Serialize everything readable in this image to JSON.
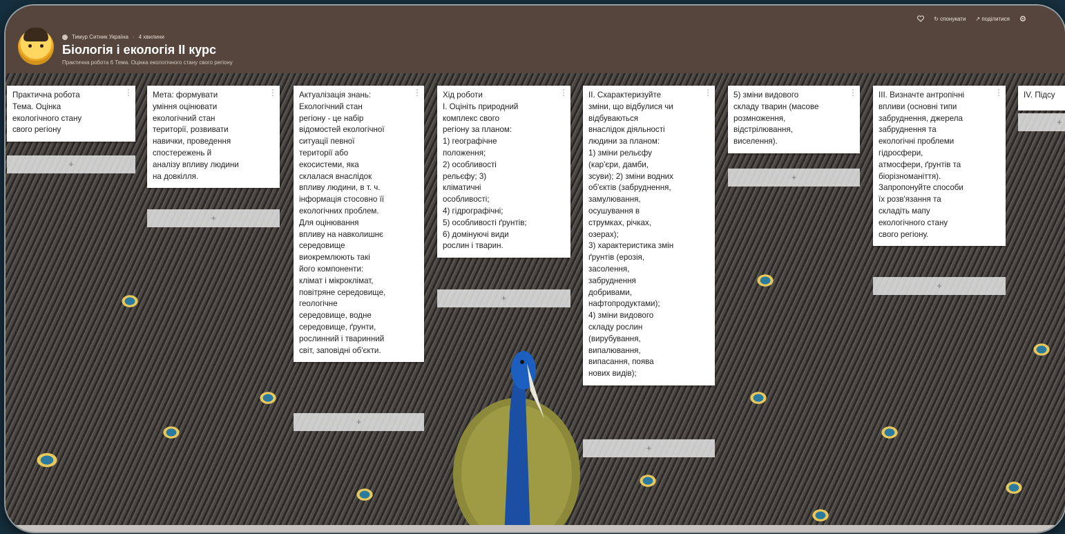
{
  "header": {
    "breadcrumb_owner": "Тимур Ситник Україна",
    "breadcrumb_sep": "·",
    "breadcrumb_count": "4 хвилини",
    "title": "Біологія і екологія ІІ курс",
    "subtitle": "Практична робота 6 Тема. Оцінка екологічного стану свого регіону",
    "actions": {
      "remake": "↻ спонукати",
      "share": "↗ поділитися"
    }
  },
  "columns": [
    {
      "text": "Практична робота\nТема. Оцінка\nекологічного стану\nсвого регіону",
      "add_label": "+"
    },
    {
      "text": "Мета: формувати\nуміння оцінювати\nекологічний стан\nтериторії, розвивати\nнавички, проведення\nспостережень й\nаналізу впливу людини\nна довкілля.",
      "add_label": "+"
    },
    {
      "text": "Актуалізація знань:\nЕкологічний стан\nрегіону - це набір\nвідомостей екологічної\nситуації певної\nтериторії або\nекосистеми, яка\nсклалася внаслідок\nвпливу людини, в т. ч.\nінформація стосовно її\nекологічних проблем.\nДля оцінювання\nвпливу на навколишнє\nсередовище\nвиокремлюють такі\nйого компоненти:\nклімат і мікроклімат,\nповітряне середовище,\nгеологічне\nсередовище, водне\nсередовище, ґрунти,\nрослинний і тваринний\nсвіт, заповідні об'єкти.",
      "add_label": "+"
    },
    {
      "text": "Хід роботи\nІ. Оцініть природний\nкомплекс свого\nрегіону за планом:\n1) географічне\nположення;\n2) особливості\nрельєфу;               3)\nкліматичні\nособливості;\n4) гідрографічні;\n5) особливості ґрунтів;\n6) домінуючі види\nрослин і тварин.",
      "add_label": "+"
    },
    {
      "text": "ІІ. Схарактеризуйте\nзміни, що відбулися чи\nвідбуваються\nвнаслідок діяльності\nлюдини за планом:\n1) зміни рельєфу\n(кар'єри, дамби,\nзсуви); 2) зміни водних\nоб'єктів (забруднення,\nзамулювання,\nосушування в\nструмках, річках,\nозерах);\n3) характеристика змін\nґрунтів (ерозія,\nзасолення,\nзабруднення\nдобривами,\nнафтопродуктами);\n4) зміни видового\nскладу рослин\n(вирубування,\nвипалювання,\nвипасання, поява\nнових видів);",
      "add_label": "+"
    },
    {
      "text": "5) зміни видового\nскладу тварин (масове\nрозмноження,\nвідстрілювання,\nвиселення).",
      "add_label": "+"
    },
    {
      "text": "ІІІ. Визначте антропічні\nвпливи (основні типи\nзабруднення, джерела\nзабруднення та\nекологічні проблеми\nгідросфери,\nатмосфери, ґрунтів та\nбіорізноманіття).\nЗапропонуйте способи\nїх розв'язання та\nскладіть мапу\nекологічного стану\nсвого регіону.",
      "add_label": "+"
    },
    {
      "text": "IV. Підсу",
      "add_label": "+"
    }
  ],
  "icons": {
    "heart": "heart-icon",
    "settings": "gear-icon",
    "card_menu": "more-vertical-icon",
    "logo": "avatar-logo"
  },
  "colors": {
    "header_bg": "#55453d",
    "card_bg": "#ffffff",
    "page_bg": "#16303f"
  }
}
